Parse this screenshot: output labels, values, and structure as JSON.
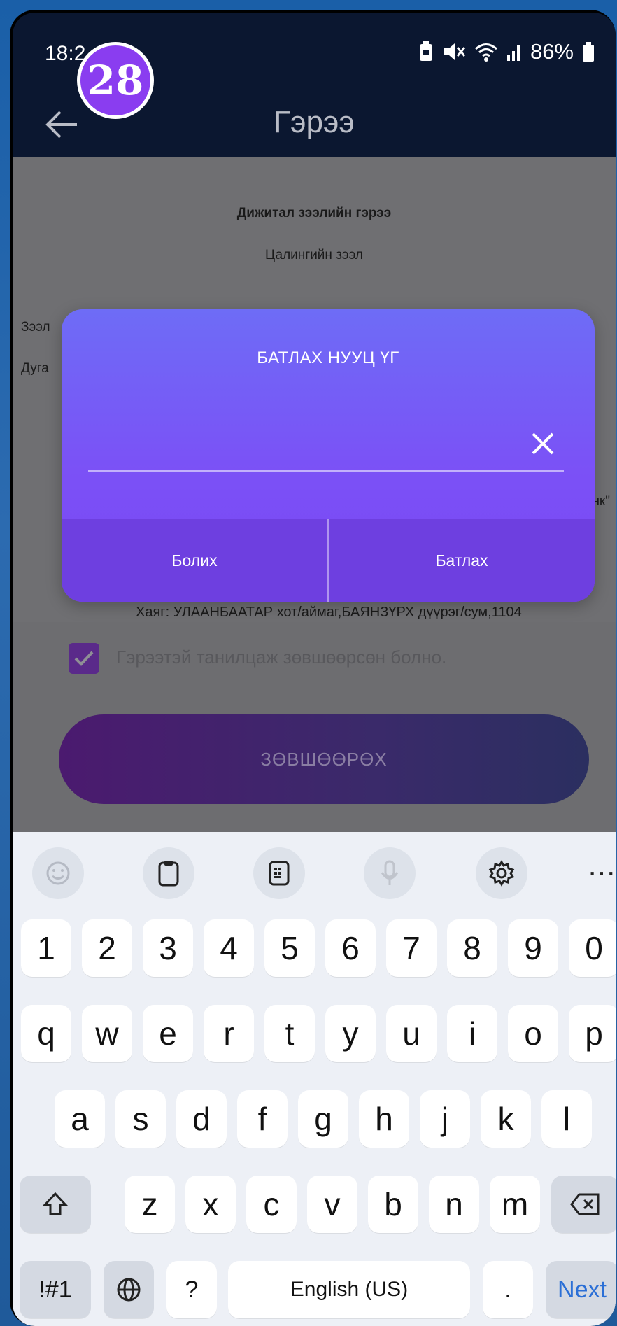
{
  "status_bar": {
    "time": "18:2",
    "battery": "86%",
    "overlay_badge": "28"
  },
  "header": {
    "title": "Гэрээ"
  },
  "document": {
    "title": "Дижитал зээлийн гэрээ",
    "subtitle": "Цалингийн зээл",
    "partial_left_1": "Зээл",
    "partial_left_2": "Дуга",
    "partial_right": "анк\"",
    "address": "Хаяг: УЛААНБААТАР хот/аймаг,БАЯНЗҮРХ дүүрэг/сум,1104"
  },
  "consent": {
    "checked": true,
    "text": "Гэрээтэй танилцаж зөвшөөрсөн болно.",
    "agree_button": "ЗӨВШӨӨРӨХ"
  },
  "dialog": {
    "title": "БАТЛАХ НУУЦ ҮГ",
    "password_value": "",
    "cancel_label": "Болих",
    "confirm_label": "Батлах"
  },
  "keyboard": {
    "toolbar": [
      "emoji-icon",
      "clipboard-icon",
      "keyboard-mode-icon",
      "microphone-icon",
      "settings-icon",
      "more-icon"
    ],
    "more_label": "⋯",
    "number_row": [
      "1",
      "2",
      "3",
      "4",
      "5",
      "6",
      "7",
      "8",
      "9",
      "0"
    ],
    "row1": [
      "q",
      "w",
      "e",
      "r",
      "t",
      "y",
      "u",
      "i",
      "o",
      "p"
    ],
    "row2": [
      "a",
      "s",
      "d",
      "f",
      "g",
      "h",
      "j",
      "k",
      "l"
    ],
    "row3": [
      "z",
      "x",
      "c",
      "v",
      "b",
      "n",
      "m"
    ],
    "symbols_label": "!#1",
    "question_label": "?",
    "space_label": "English (US)",
    "period_label": ".",
    "next_label": "Next"
  }
}
